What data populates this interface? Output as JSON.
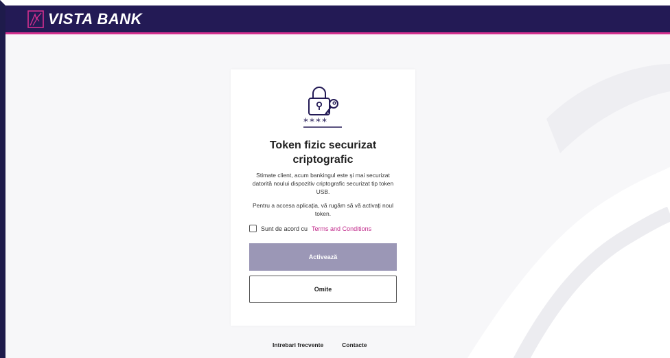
{
  "header": {
    "brand": "VISTA BANK"
  },
  "card": {
    "title": "Token fizic securizat criptografic",
    "description": "Stimate client, acum bankingul este și mai securizat datorită noului dispozitiv criptografic securizat tip token USB.",
    "instruction": "Pentru a accesa aplicația, vă rugăm să vă activați noul token.",
    "agree_prefix": "Sunt de acord cu",
    "agree_link": "Terms and Conditions",
    "primary_button": "Activează",
    "secondary_button": "Omite",
    "icon": "padlock-key-password-icon"
  },
  "footer": {
    "faq": "Intrebari frecvente",
    "contact": "Contacte"
  },
  "colors": {
    "header_bg": "#231a55",
    "accent": "#d4308f",
    "link": "#c1288a",
    "primary_disabled": "#9b97b6"
  }
}
